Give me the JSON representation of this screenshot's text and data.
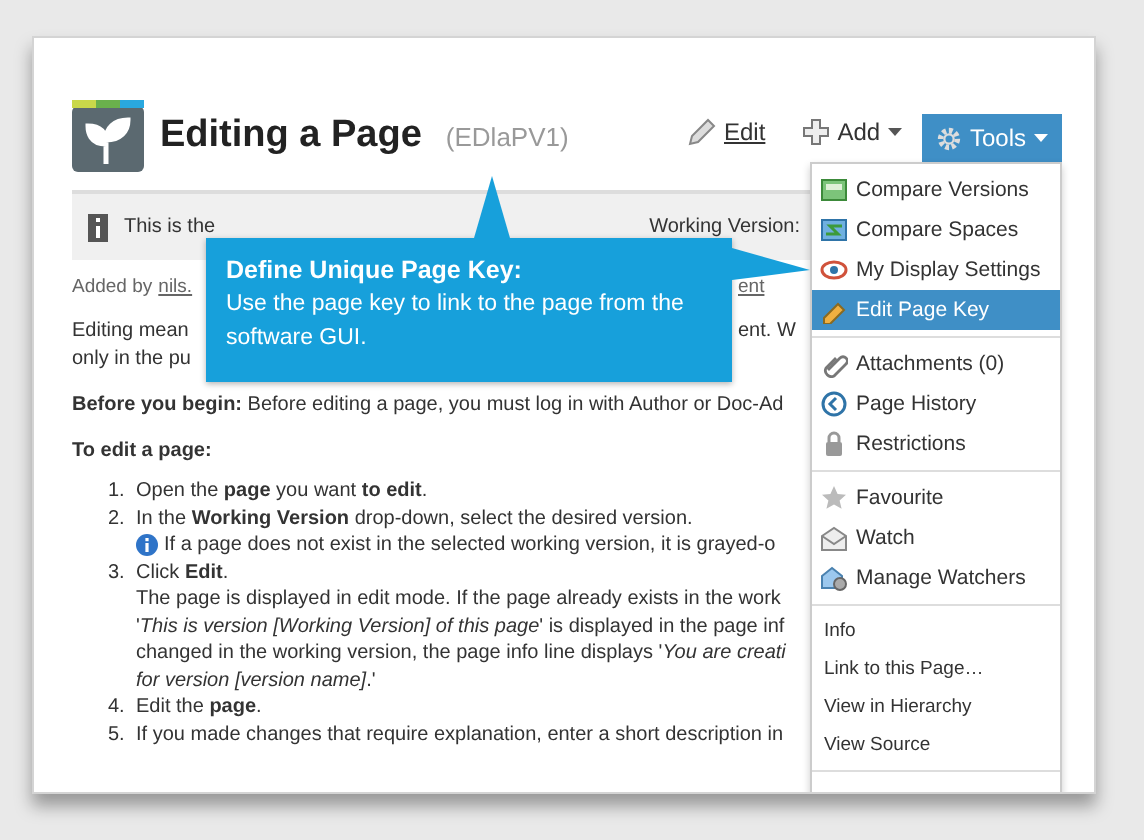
{
  "header": {
    "title": "Editing a Page",
    "page_key": "(EDlaPV1)",
    "edit_action": "Edit",
    "add_action": "Add",
    "tools_button": "Tools"
  },
  "info_bar": {
    "text": "This is the",
    "working_version_label": "Working Version:"
  },
  "byline": {
    "prefix": "Added by",
    "author": "nils.",
    "trailing_link": "ent"
  },
  "intro_lines": [
    {
      "left": "Editing mean",
      "right": "ent. W"
    },
    {
      "left": "only in the pu"
    }
  ],
  "before_you_begin": "**Before you begin:** Before editing a page, you must log in with Author or Doc-Ad",
  "procedure": {
    "heading": "To edit a page:",
    "steps": [
      {
        "number": "1.",
        "text": "Open the **page** you want **to edit**."
      },
      {
        "number": "2.",
        "text": "In the **Working Version** drop-down, select the desired version.",
        "note": "If a page does not exist in the selected working version, it is grayed-o"
      },
      {
        "number": "3.",
        "text": "Click **Edit**.",
        "detail_lines": [
          "The page is displayed in edit mode. If the page already exists in the work",
          "'*This is version [Working Version] of this page*' is displayed in the page inf",
          "changed in the working version, the page info line displays '*You are creati*",
          "*for version [version name]*.'"
        ]
      },
      {
        "number": "4.",
        "text": "Edit the **page**."
      },
      {
        "number": "5.",
        "text": "If you made changes that require explanation, enter a short description in"
      }
    ]
  },
  "tools_menu": [
    {
      "kind": "icon",
      "items": [
        {
          "label": "Compare Versions",
          "selected": false
        },
        {
          "label": "Compare Spaces",
          "selected": false
        },
        {
          "label": "My Display Settings",
          "selected": false
        },
        {
          "label": "Edit Page Key",
          "selected": true
        }
      ]
    },
    {
      "kind": "icon",
      "items": [
        {
          "label": "Attachments (0)",
          "selected": false
        },
        {
          "label": "Page History",
          "selected": false
        },
        {
          "label": "Restrictions",
          "selected": false
        }
      ]
    },
    {
      "kind": "icon",
      "items": [
        {
          "label": "Favourite",
          "selected": false
        },
        {
          "label": "Watch",
          "selected": false
        },
        {
          "label": "Manage Watchers",
          "selected": false
        }
      ]
    },
    {
      "kind": "plain",
      "items": [
        {
          "label": "Info",
          "selected": false
        },
        {
          "label": "Link to this Page…",
          "selected": false
        },
        {
          "label": "View in Hierarchy",
          "selected": false
        },
        {
          "label": "View Source",
          "selected": false
        }
      ]
    }
  ],
  "callout": {
    "title": "Define Unique Page Key:",
    "text": "Use the page key to link to the page from the software GUI."
  }
}
